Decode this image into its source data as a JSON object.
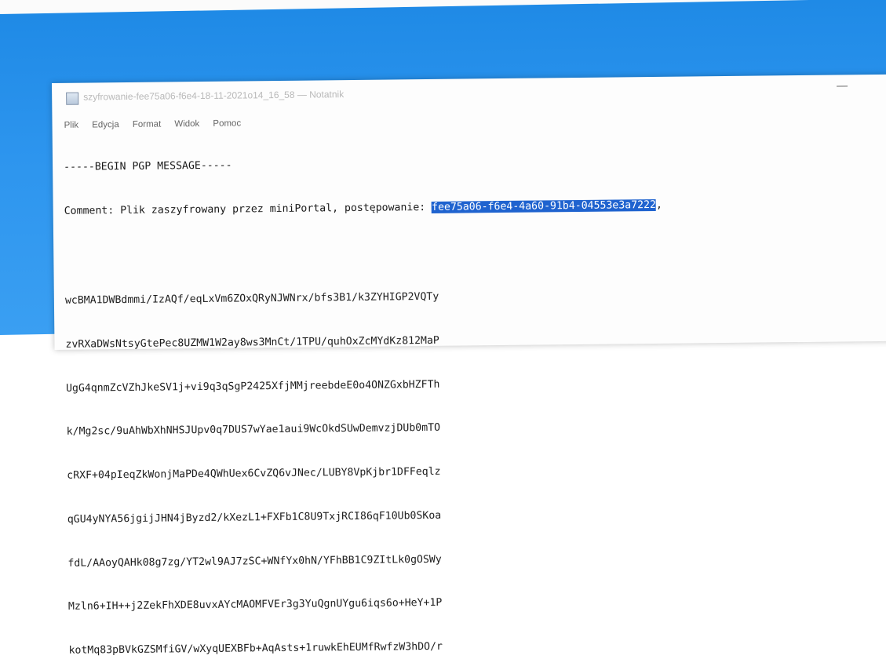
{
  "window": {
    "title": "szyfrowanie-fee75a06-f6e4-18-11-2021o14_16_58 — Notatnik"
  },
  "menu": [
    "Plik",
    "Edycja",
    "Format",
    "Widok",
    "Pomoc"
  ],
  "editor": {
    "header_line": "-----BEGIN PGP MESSAGE-----",
    "comment_prefix": "Comment: Plik zaszyfrowany przez miniPortal, postępowanie: ",
    "comment_selected": "fee75a06-f6e4-4a60-91b4-04553e3a7222",
    "comment_suffix": ", ",
    "body_lines": [
      "wcBMA1DWBdmmi/IzAQf/eqLxVm6ZOxQRyNJWNrx/bfs3B1/k3ZYHIGP2VQTy",
      "zvRXaDWsNtsyGtePec8UZMW1W2ay8ws3MnCt/1TPU/quhOxZcMYdKz812MaP",
      "UgG4qnmZcVZhJkeSV1j+vi9q3qSgP2425XfjMMjreebdeE0o4ONZGxbHZFTh",
      "k/Mg2sc/9uAhWbXhNHSJUpv0q7DUS7wYae1aui9WcOkdSUwDemvzjDUb0mTO",
      "cRXF+04pIeqZkWonjMaPDe4QWhUex6CvZQ6vJNec/LUBY8VpKjbr1DFFeqlz",
      "qGU4yNYA56jgijJHN4jByzd2/kXezL1+FXFb1C8U9TxjRCI86qF10Ub0SKoa",
      "fdL/AAoyQAHk08g7zg/YT2wl9AJ7zSC+WNfYx0hN/YFhBB1C9ZItLk0gOSWy",
      "Mzln6+IH++j2ZekFhXDE8uvxAYcMAOMFVEr3g3YuQgnUYgu6iqs6o+HeY+1P",
      "kotMq83pBVkGZSMfiGV/wXyqUEXBFb+AqAsts+1ruwkEhEUMfRwfzW3hDO/r"
    ]
  }
}
